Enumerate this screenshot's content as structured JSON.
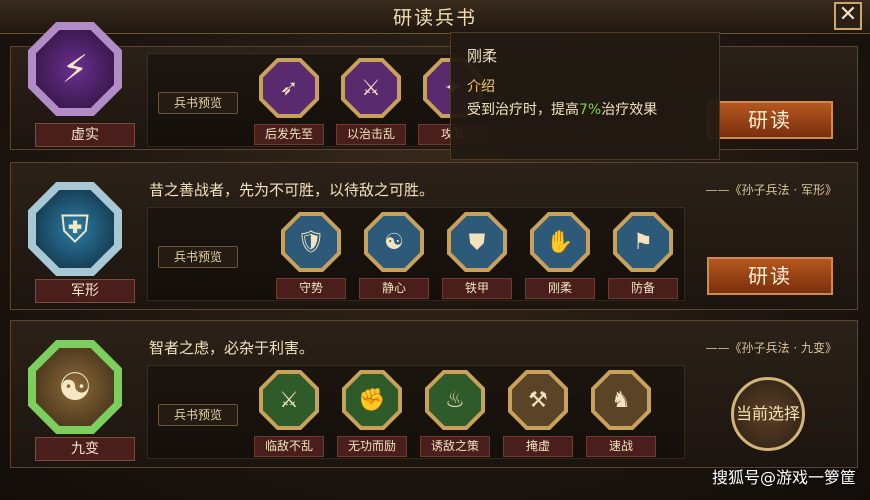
{
  "title": "研读兵书",
  "close_symbol": "✕",
  "preview_label": "兵书预览",
  "rows": [
    {
      "name": "虚实",
      "quote": "",
      "source": "",
      "color": "#8a3ec0",
      "skills": [
        "后发先至",
        "以治击乱",
        "攻其"
      ],
      "action": "研读"
    },
    {
      "name": "军形",
      "quote": "昔之善战者，先为不可胜，以待敌之可胜。",
      "source": "——《孙子兵法 · 军形》",
      "color": "#2aa6d8",
      "skills": [
        "守势",
        "静心",
        "铁甲",
        "刚柔",
        "防备"
      ],
      "action": "研读"
    },
    {
      "name": "九变",
      "quote": "智者之虑，必杂于利害。",
      "source": "——《孙子兵法 · 九变》",
      "color": "#3d9a3a",
      "skills": [
        "临敌不乱",
        "无功而励",
        "诱敌之策",
        "掩虚",
        "速战"
      ],
      "action": "当前选择"
    }
  ],
  "tooltip": {
    "title": "刚柔",
    "subtitle": "介绍",
    "desc_before": "受到治疗时，提高",
    "desc_highlight": "7%",
    "desc_after": "治疗效果"
  },
  "watermark": "搜狐号@游戏一箩筐"
}
